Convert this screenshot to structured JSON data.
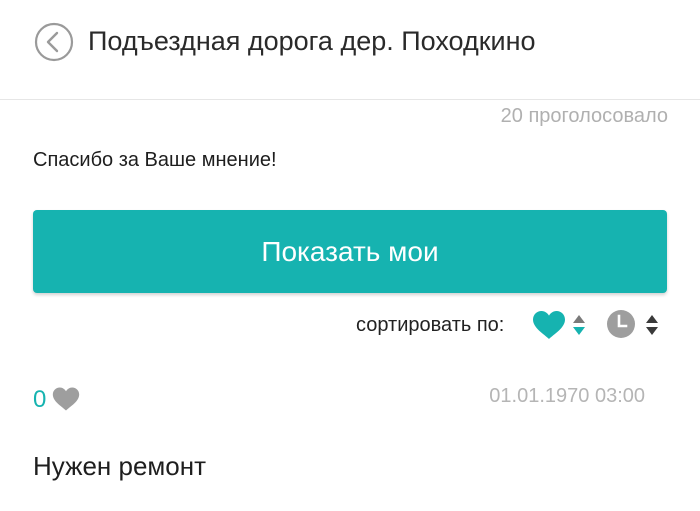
{
  "header": {
    "title": "Подъездная дорога дер. Походкино",
    "back_icon": "chevron-left-circle-icon"
  },
  "poll": {
    "votes_text": "20 проголосовало",
    "thanks_text": "Спасибо за Ваше мнение!",
    "show_mine_label": "Показать мои"
  },
  "sort": {
    "label": "сортировать по:",
    "by_likes_icon": "heart-icon",
    "by_date_icon": "clock-icon"
  },
  "items": [
    {
      "likes": "0",
      "date": "01.01.1970 03:00",
      "text": "Нужен ремонт"
    }
  ],
  "colors": {
    "accent": "#16b3b0",
    "muted": "#b0b0b0",
    "icon_gray": "#9e9e9e"
  }
}
